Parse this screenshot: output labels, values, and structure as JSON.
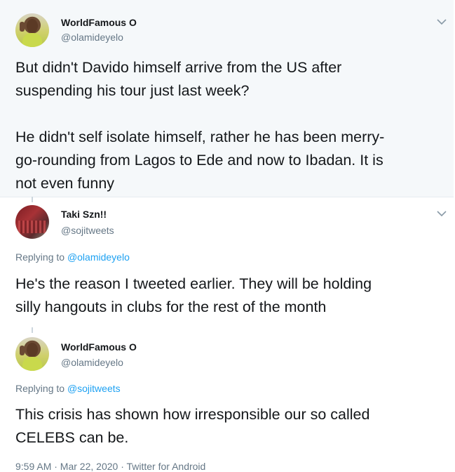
{
  "tweets": [
    {
      "name": "WorldFamous O",
      "handle": "@olamideyelo",
      "replying_prefix": "",
      "replying_to": "",
      "text": "But didn't Davido himself arrive from the US after\nsuspending his tour just last week?\n\nHe didn't self isolate himself, rather he has been merry-\ngo-rounding from Lagos to Ede and now to Ibadan. It is\nnot even funny"
    },
    {
      "name": "Taki Szn!!",
      "handle": "@sojitweets",
      "replying_prefix": "Replying to ",
      "replying_to": "@olamideyelo",
      "text": "He's the reason I tweeted earlier. They will be holding\nsilly hangouts in clubs for the rest of the month"
    },
    {
      "name": "WorldFamous O",
      "handle": "@olamideyelo",
      "replying_prefix": "Replying to ",
      "replying_to": "@sojitweets",
      "text": "This crisis has shown how irresponsible our so called\nCELEBS can be.",
      "meta": "9:59 AM · Mar 22, 2020 · Twitter for Android"
    }
  ],
  "icons": {
    "menu": "chevron-down-icon"
  },
  "colors": {
    "link": "#1da1f2",
    "muted": "#657786",
    "text": "#14171a"
  }
}
